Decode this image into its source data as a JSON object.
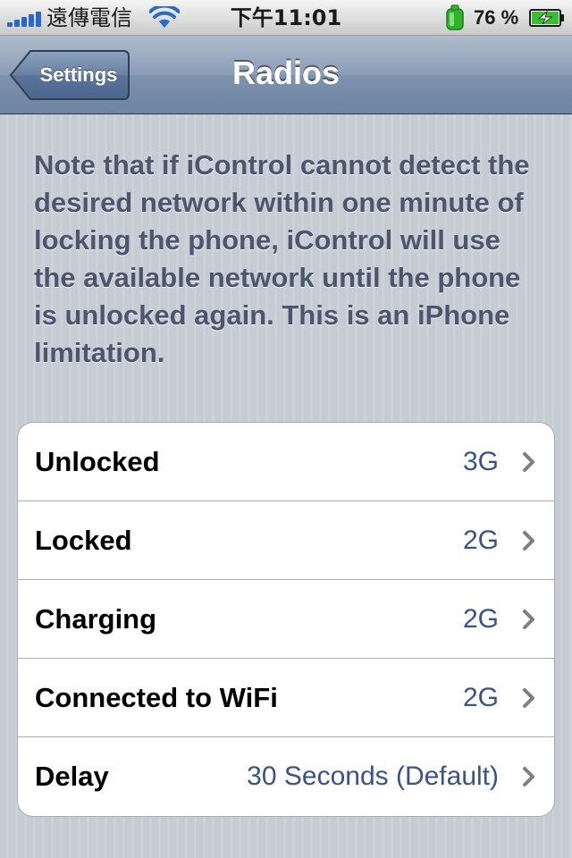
{
  "status_bar": {
    "carrier": "遠傳電信",
    "time": "下午11:01",
    "battery_percent": "76 %",
    "signal_bars": 5,
    "icons": [
      "signal-bars-icon",
      "wifi-icon",
      "gps-icon",
      "battery-charging-icon"
    ]
  },
  "nav": {
    "back_label": "Settings",
    "title": "Radios"
  },
  "note": "Note that if iControl cannot detect the desired network within one minute of locking the phone, iControl will use the available network until the phone is unlocked again. This is an iPhone limitation.",
  "rows": [
    {
      "label": "Unlocked",
      "value": "3G"
    },
    {
      "label": "Locked",
      "value": "2G"
    },
    {
      "label": "Charging",
      "value": "2G"
    },
    {
      "label": "Connected to WiFi",
      "value": "2G"
    },
    {
      "label": "Delay",
      "value": "30 Seconds (Default)"
    }
  ],
  "colors": {
    "nav_bar": "#7d92ad",
    "value_text": "#385487",
    "note_text": "#4c566c",
    "signal": "#2a68c8",
    "battery": "#36c22e"
  }
}
